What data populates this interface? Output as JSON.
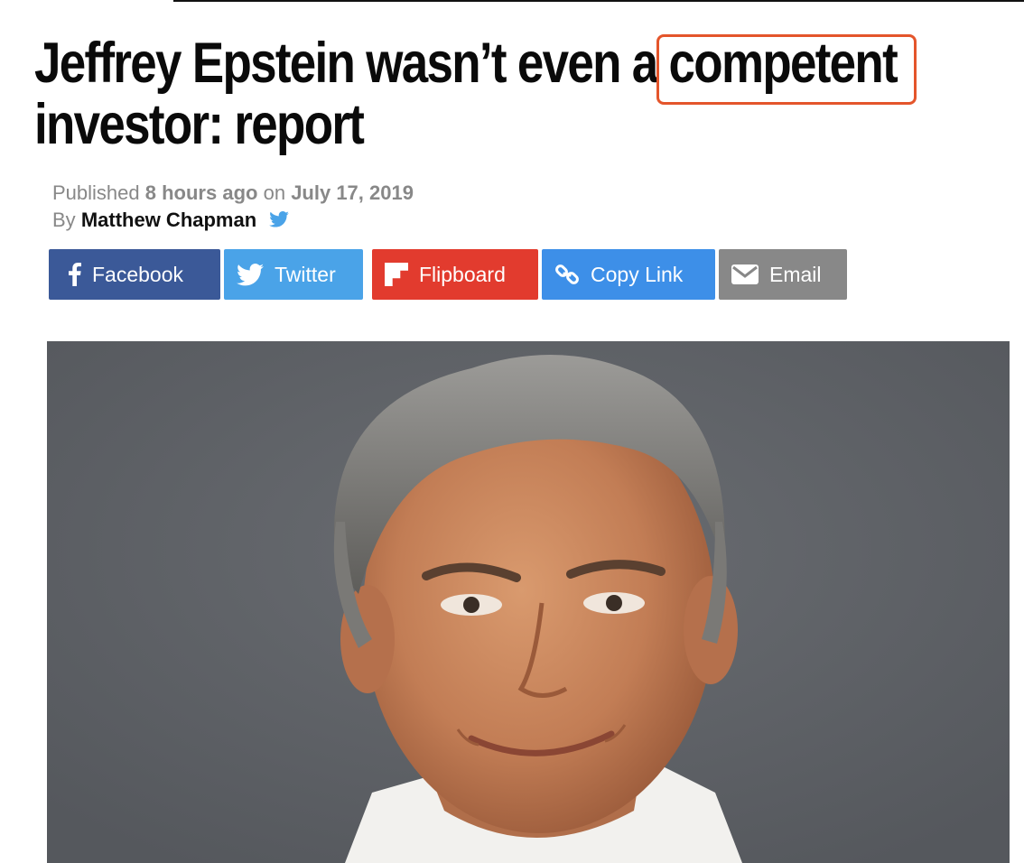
{
  "article": {
    "headline_line1_pre": "Jeffrey Epstein wasn’t even a ",
    "headline_highlight": "competent",
    "headline_line2": "investor: report",
    "meta": {
      "published_label": "Published",
      "relative_time": "8 hours ago",
      "on_label": "on",
      "date": "July 17, 2019",
      "by_label": "By",
      "author": "Matthew Chapman"
    }
  },
  "share": {
    "buttons": [
      {
        "label": "Facebook",
        "icon": "facebook-icon",
        "color": "#3b5998"
      },
      {
        "label": "Twitter",
        "icon": "twitter-icon",
        "color": "#4aa3e8"
      },
      {
        "label": "Flipboard",
        "icon": "flipboard-icon",
        "color": "#e23b2e"
      },
      {
        "label": "Copy Link",
        "icon": "link-icon",
        "color": "#3d8fe8"
      },
      {
        "label": "Email",
        "icon": "envelope-icon",
        "color": "#888888"
      }
    ]
  },
  "colors": {
    "highlight_box": "#e4552b",
    "photo_background": "#5e6166"
  }
}
